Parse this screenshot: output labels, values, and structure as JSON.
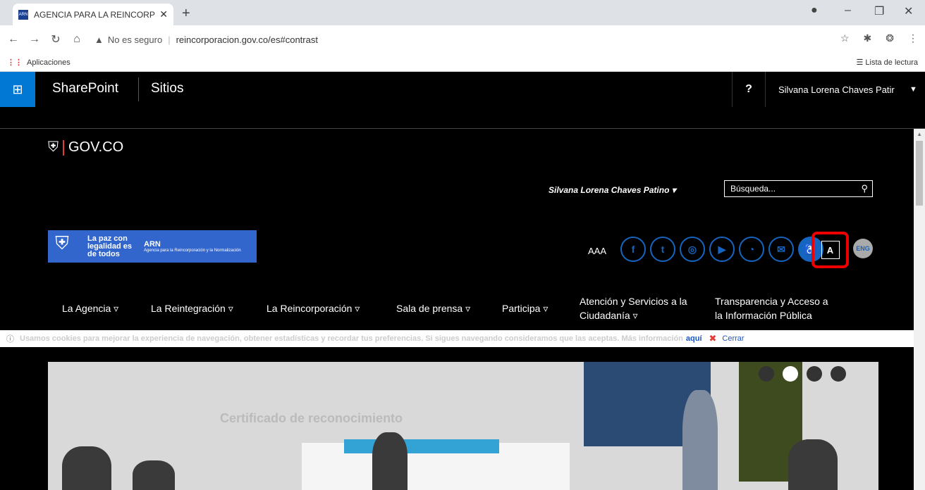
{
  "browser": {
    "tab_title": "AGENCIA PARA LA REINCORPOR",
    "favicon_text": "ARN",
    "security_label": "No es seguro",
    "url": "reincorporacion.gov.co/es#contrast",
    "bookmark_apps": "Aplicaciones",
    "reading_list": "Lista de lectura"
  },
  "sharepoint": {
    "brand": "SharePoint",
    "sites": "Sitios",
    "help": "?",
    "user": "Silvana Lorena Chaves Patir"
  },
  "page": {
    "gov_label": "GOV.CO",
    "user_name": "Silvana Lorena Chaves Patino",
    "search_placeholder": "Búsqueda...",
    "logo_paz": "La paz con legalidad es de todos",
    "logo_arn": "ARN",
    "logo_arn_sub": "Agencia para la Reincorporación y la Normalización",
    "font_size_control": "AAA",
    "contrast_button": "A",
    "language_button": "ENG"
  },
  "menu": [
    {
      "label": "La Agencia"
    },
    {
      "label": "La Reintegración"
    },
    {
      "label": "La Reincorporación"
    },
    {
      "label": "Sala de prensa"
    },
    {
      "label": "Participa"
    },
    {
      "label": "Atención y Servicios a la Ciudadanía"
    },
    {
      "label": "Transparencia y Acceso a la Información Pública"
    }
  ],
  "cookie": {
    "text": "Usamos cookies para mejorar la experiencia de navegación, obtener estadísticas y recordar tus preferencias. Si sigues navegando consideramos que las aceptas. Más información",
    "link": "aquí",
    "close": "Cerrar"
  },
  "hero": {
    "faded_text": "Certificado de reconocimiento",
    "active_slide": 2,
    "slides": 4
  },
  "colors": {
    "sharepoint_blue": "#0078d4",
    "contrast_highlight": "#e00000",
    "social_blue": "#1565c0"
  }
}
